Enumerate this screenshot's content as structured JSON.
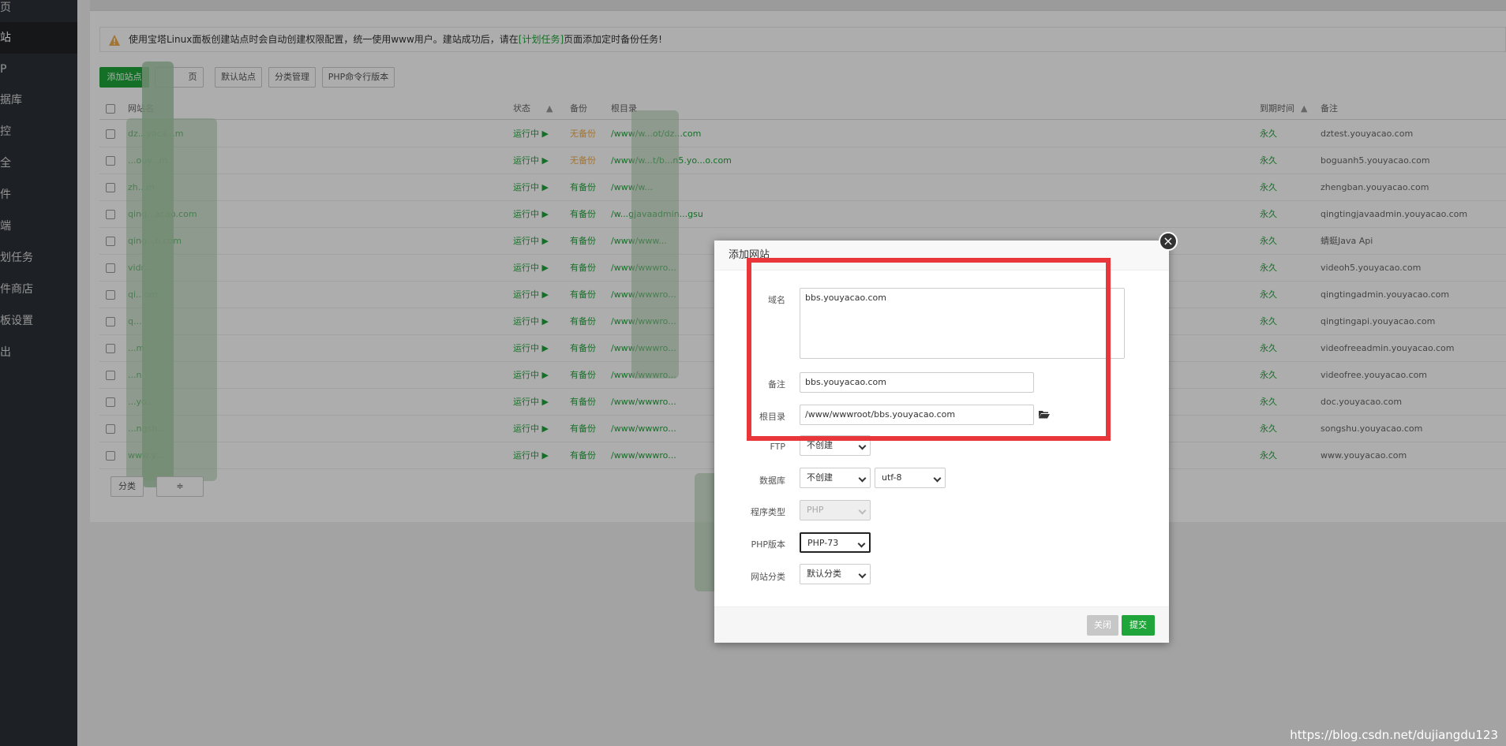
{
  "sidebar": {
    "items": [
      {
        "label": "页"
      },
      {
        "label": "站"
      },
      {
        "label": "P"
      },
      {
        "label": "据库"
      },
      {
        "label": "控"
      },
      {
        "label": "全"
      },
      {
        "label": "件"
      },
      {
        "label": "端"
      },
      {
        "label": "划任务"
      },
      {
        "label": "件商店"
      },
      {
        "label": "板设置"
      },
      {
        "label": "出"
      }
    ],
    "active_index": 1
  },
  "notice": {
    "text_before": "使用宝塔Linux面板创建站点时会自动创建权限配置，统一使用www用户。建站成功后，请在",
    "link": "[计划任务]",
    "text_after": "页面添加定时备份任务!"
  },
  "toolbar": {
    "add_site": "添加站点",
    "btn2": "页",
    "default_site": "默认站点",
    "category_manage": "分类管理",
    "php_cli": "PHP命令行版本"
  },
  "table": {
    "headers": {
      "name": "网站名",
      "status": "状态",
      "backup": "备份",
      "root": "根目录",
      "expire": "到期时间",
      "note": "备注"
    },
    "rows": [
      {
        "name": "dz...yaca...m",
        "status": "运行中 ▶",
        "backup": "无备份",
        "backup_color": "orange",
        "path": "/www/w...ot/dz...com",
        "expire": "永久",
        "note": "dztest.youyacao.com"
      },
      {
        "name": "...ouy...m",
        "status": "运行中 ▶",
        "backup": "无备份",
        "backup_color": "orange",
        "path": "/www/w...t/b...n5.yo...o.com",
        "expire": "永久",
        "note": "boguanh5.youyacao.com"
      },
      {
        "name": "zh...m",
        "status": "运行中 ▶",
        "backup": "有备份",
        "backup_color": "green",
        "path": "/www/w...",
        "expire": "永久",
        "note": "zhengban.youyacao.com"
      },
      {
        "name": "qing...acao.com",
        "status": "运行中 ▶",
        "backup": "有备份",
        "backup_color": "green",
        "path": "/w...gjavaadmin...gsu",
        "expire": "永久",
        "note": "qingtingjavaadmin.youyacao.com"
      },
      {
        "name": "qing...o.com",
        "status": "运行中 ▶",
        "backup": "有备份",
        "backup_color": "green",
        "path": "/www/www...",
        "expire": "永久",
        "note": "蜻蜓Java Api"
      },
      {
        "name": "vidr...",
        "status": "运行中 ▶",
        "backup": "有备份",
        "backup_color": "green",
        "path": "/www/wwwro...",
        "expire": "永久",
        "note": "videoh5.youyacao.com"
      },
      {
        "name": "qi...om",
        "status": "运行中 ▶",
        "backup": "有备份",
        "backup_color": "green",
        "path": "/www/wwwro...",
        "expire": "永久",
        "note": "qingtingadmin.youyacao.com"
      },
      {
        "name": "q...",
        "status": "运行中 ▶",
        "backup": "有备份",
        "backup_color": "green",
        "path": "/www/wwwro...",
        "expire": "永久",
        "note": "qingtingapi.youyacao.com"
      },
      {
        "name": "...m",
        "status": "运行中 ▶",
        "backup": "有备份",
        "backup_color": "green",
        "path": "/www/wwwro...",
        "expire": "永久",
        "note": "videofreeadmin.youyacao.com"
      },
      {
        "name": "...n",
        "status": "运行中 ▶",
        "backup": "有备份",
        "backup_color": "green",
        "path": "/www/wwwro...",
        "expire": "永久",
        "note": "videofree.youyacao.com"
      },
      {
        "name": "...yo...",
        "status": "运行中 ▶",
        "backup": "有备份",
        "backup_color": "green",
        "path": "/www/wwwro...",
        "expire": "永久",
        "note": "doc.youyacao.com"
      },
      {
        "name": "...ngsh...",
        "status": "运行中 ▶",
        "backup": "有备份",
        "backup_color": "green",
        "path": "/www/wwwro...",
        "expire": "永久",
        "note": "songshu.youyacao.com"
      },
      {
        "name": "www.y...",
        "status": "运行中 ▶",
        "backup": "有备份",
        "backup_color": "green",
        "path": "/www/wwwro...",
        "expire": "永久",
        "note": "www.youyacao.com"
      }
    ],
    "footer_btn": "分类",
    "footer_btn2": "≑"
  },
  "dialog": {
    "title": "添加网站",
    "close_glyph": "×",
    "domain_label": "域名",
    "domain_value": "bbs.youyacao.com",
    "note_label": "备注",
    "note_value": "bbs.youyacao.com",
    "root_label": "根目录",
    "root_value": "/www/wwwroot/bbs.youyacao.com",
    "ftp_label": "FTP",
    "ftp_value": "不创建",
    "db_label": "数据库",
    "db_value": "不创建",
    "charset_value": "utf-8",
    "program_label": "程序类型",
    "program_value": "PHP",
    "php_label": "PHP版本",
    "php_value": "PHP-73",
    "category_label": "网站分类",
    "category_value": "默认分类",
    "close_btn": "关闭",
    "submit_btn": "提交"
  },
  "colors": {
    "accent": "#20a53a",
    "warning": "#f0ad4e",
    "highlight": "#e8363b",
    "sidebar_bg": "#2c3138"
  },
  "watermark": "https://blog.csdn.net/dujiangdu123"
}
